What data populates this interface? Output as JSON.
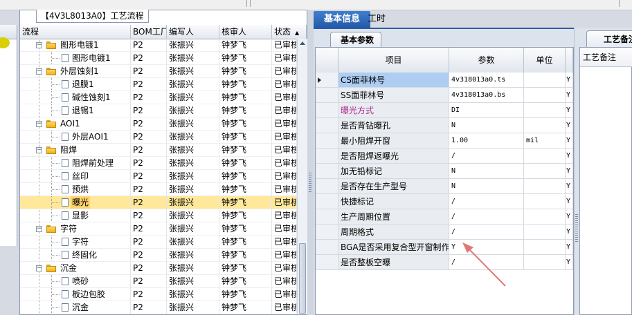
{
  "tree_panel": {
    "title": "【4V3L8013A0】工艺流程",
    "columns": [
      "流程",
      "BOM工厂",
      "编写人",
      "核审人",
      "状态"
    ],
    "rows": [
      {
        "label": "图形电镀1",
        "level": 1,
        "kind": "folder",
        "bom": "P2",
        "writer": "张振兴",
        "checker": "钟梦飞",
        "state": "已审核"
      },
      {
        "label": "图形电镀1",
        "level": 2,
        "kind": "doc",
        "bom": "P2",
        "writer": "张振兴",
        "checker": "钟梦飞",
        "state": "已审核"
      },
      {
        "label": "外层蚀刻1",
        "level": 1,
        "kind": "folder",
        "bom": "P2",
        "writer": "张振兴",
        "checker": "钟梦飞",
        "state": "已审核"
      },
      {
        "label": "退膜1",
        "level": 2,
        "kind": "doc",
        "bom": "P2",
        "writer": "张振兴",
        "checker": "钟梦飞",
        "state": "已审核"
      },
      {
        "label": "碱性蚀刻1",
        "level": 2,
        "kind": "doc",
        "bom": "P2",
        "writer": "张振兴",
        "checker": "钟梦飞",
        "state": "已审核"
      },
      {
        "label": "退锡1",
        "level": 2,
        "kind": "doc",
        "bom": "P2",
        "writer": "张振兴",
        "checker": "钟梦飞",
        "state": "已审核"
      },
      {
        "label": "AOI1",
        "level": 1,
        "kind": "folder",
        "bom": "P2",
        "writer": "张振兴",
        "checker": "钟梦飞",
        "state": "已审核"
      },
      {
        "label": "外层AOI1",
        "level": 2,
        "kind": "doc",
        "bom": "P2",
        "writer": "张振兴",
        "checker": "钟梦飞",
        "state": "已审核"
      },
      {
        "label": "阻焊",
        "level": 1,
        "kind": "folder",
        "bom": "P2",
        "writer": "张振兴",
        "checker": "钟梦飞",
        "state": "已审核"
      },
      {
        "label": "阻焊前处理",
        "level": 2,
        "kind": "doc",
        "bom": "P2",
        "writer": "张振兴",
        "checker": "钟梦飞",
        "state": "已审核"
      },
      {
        "label": "丝印",
        "level": 2,
        "kind": "doc",
        "bom": "P2",
        "writer": "张振兴",
        "checker": "钟梦飞",
        "state": "已审核"
      },
      {
        "label": "预烘",
        "level": 2,
        "kind": "doc",
        "bom": "P2",
        "writer": "张振兴",
        "checker": "钟梦飞",
        "state": "已审核"
      },
      {
        "label": "曝光",
        "level": 2,
        "kind": "doc",
        "bom": "P2",
        "writer": "张振兴",
        "checker": "钟梦飞",
        "state": "已审核",
        "selected": true
      },
      {
        "label": "显影",
        "level": 2,
        "kind": "doc",
        "bom": "P2",
        "writer": "张振兴",
        "checker": "钟梦飞",
        "state": "已审核"
      },
      {
        "label": "字符",
        "level": 1,
        "kind": "folder",
        "bom": "P2",
        "writer": "张振兴",
        "checker": "钟梦飞",
        "state": "已审核"
      },
      {
        "label": "字符",
        "level": 2,
        "kind": "doc",
        "bom": "P2",
        "writer": "张振兴",
        "checker": "钟梦飞",
        "state": "已审核"
      },
      {
        "label": "终固化",
        "level": 2,
        "kind": "doc",
        "bom": "P2",
        "writer": "张振兴",
        "checker": "钟梦飞",
        "state": "已审核"
      },
      {
        "label": "沉金",
        "level": 1,
        "kind": "folder",
        "bom": "P2",
        "writer": "张振兴",
        "checker": "钟梦飞",
        "state": "已审核"
      },
      {
        "label": "喷砂",
        "level": 2,
        "kind": "doc",
        "bom": "P2",
        "writer": "张振兴",
        "checker": "钟梦飞",
        "state": "已审核"
      },
      {
        "label": "板边包胶",
        "level": 2,
        "kind": "doc",
        "bom": "P2",
        "writer": "张振兴",
        "checker": "钟梦飞",
        "state": "已审核"
      },
      {
        "label": "沉金",
        "level": 2,
        "kind": "doc",
        "bom": "P2",
        "writer": "张振兴",
        "checker": "钟梦飞",
        "state": "已审核"
      }
    ]
  },
  "tabs": {
    "basic_info": "基本信息",
    "work_hours": "工时",
    "sub_basic_params": "基本参数",
    "process_notes": "工艺备注"
  },
  "grid": {
    "columns": [
      "项目",
      "参数",
      "单位"
    ],
    "rows": [
      {
        "item": "CS面菲林号",
        "param": "4v318013a0.ts",
        "unit": "",
        "flag": "Y",
        "current": true
      },
      {
        "item": "SS面菲林号",
        "param": "4v318013a0.bs",
        "unit": "",
        "flag": "Y"
      },
      {
        "item": "曝光方式",
        "param": "DI",
        "unit": "",
        "flag": "Y",
        "highlight": true
      },
      {
        "item": "是否背钻曝孔",
        "param": "N",
        "unit": "",
        "flag": "Y"
      },
      {
        "item": "最小阻焊开窗",
        "param": "1.00",
        "unit": "mil",
        "flag": "Y"
      },
      {
        "item": "是否阻焊返曝光",
        "param": "/",
        "unit": "",
        "flag": "Y"
      },
      {
        "item": "加无铅标记",
        "param": "N",
        "unit": "",
        "flag": "Y"
      },
      {
        "item": "是否存在生产型号",
        "param": "N",
        "unit": "",
        "flag": "Y"
      },
      {
        "item": "快捷标记",
        "param": "/",
        "unit": "",
        "flag": "Y"
      },
      {
        "item": "生产周期位置",
        "param": "/",
        "unit": "",
        "flag": "Y"
      },
      {
        "item": "周期格式",
        "param": "/",
        "unit": "",
        "flag": "Y"
      },
      {
        "item": "BGA是否采用复合型开窗制作",
        "param": "Y",
        "unit": "",
        "flag": "Y"
      },
      {
        "item": "是否整板空曝",
        "param": "/",
        "unit": "",
        "flag": "Y"
      }
    ]
  },
  "notes_panel": {
    "header": "工艺备注"
  },
  "colors": {
    "accent": "#2459a8",
    "highlight_text": "#b0288c",
    "selection": "#ffe89a",
    "annotation_arrow": "#e07878"
  }
}
